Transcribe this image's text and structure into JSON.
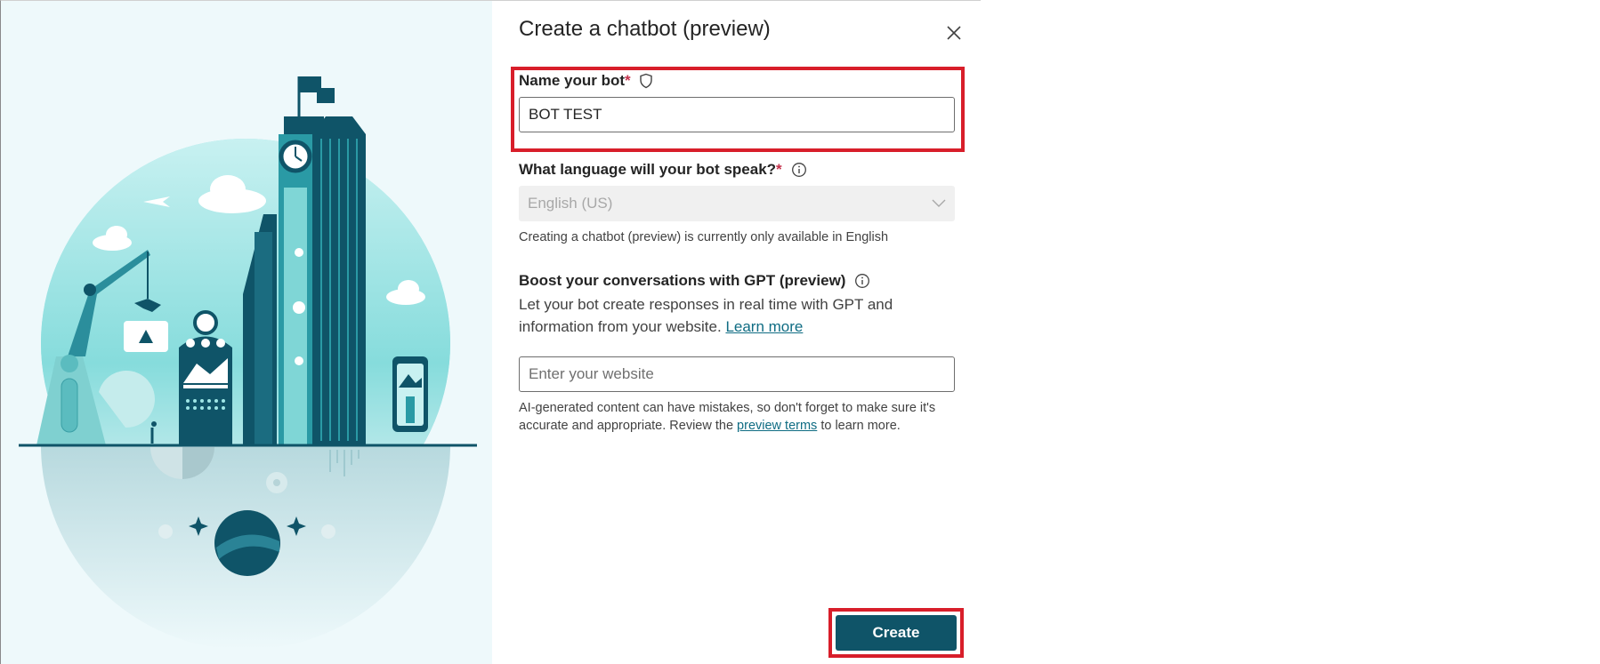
{
  "dialog": {
    "title": "Create a chatbot (preview)",
    "close_icon": "close-icon"
  },
  "name_field": {
    "label": "Name your bot",
    "required_mark": "*",
    "icon": "shield-icon",
    "value": "BOT TEST"
  },
  "language_field": {
    "label": "What language will your bot speak?",
    "required_mark": "*",
    "icon": "info-icon",
    "selected": "English (US)",
    "helper": "Creating a chatbot (preview) is currently only available in English"
  },
  "gpt_section": {
    "label": "Boost your conversations with GPT (preview)",
    "icon": "info-icon",
    "description": "Let your bot create responses in real time with GPT and information from your website.",
    "learn_more": "Learn more",
    "website_placeholder": "Enter your website",
    "disclaimer_start": "AI-generated content can have mistakes, so don't forget to make sure it's accurate and appropriate. Review the",
    "preview_terms": "preview terms",
    "disclaimer_end": "to learn more."
  },
  "actions": {
    "create_label": "Create"
  },
  "colors": {
    "accent": "#0f5468",
    "highlight": "#d81e2a",
    "illustration_bg": "#eef9fb",
    "teal": "#7fdde0",
    "link": "#0f6c83"
  }
}
